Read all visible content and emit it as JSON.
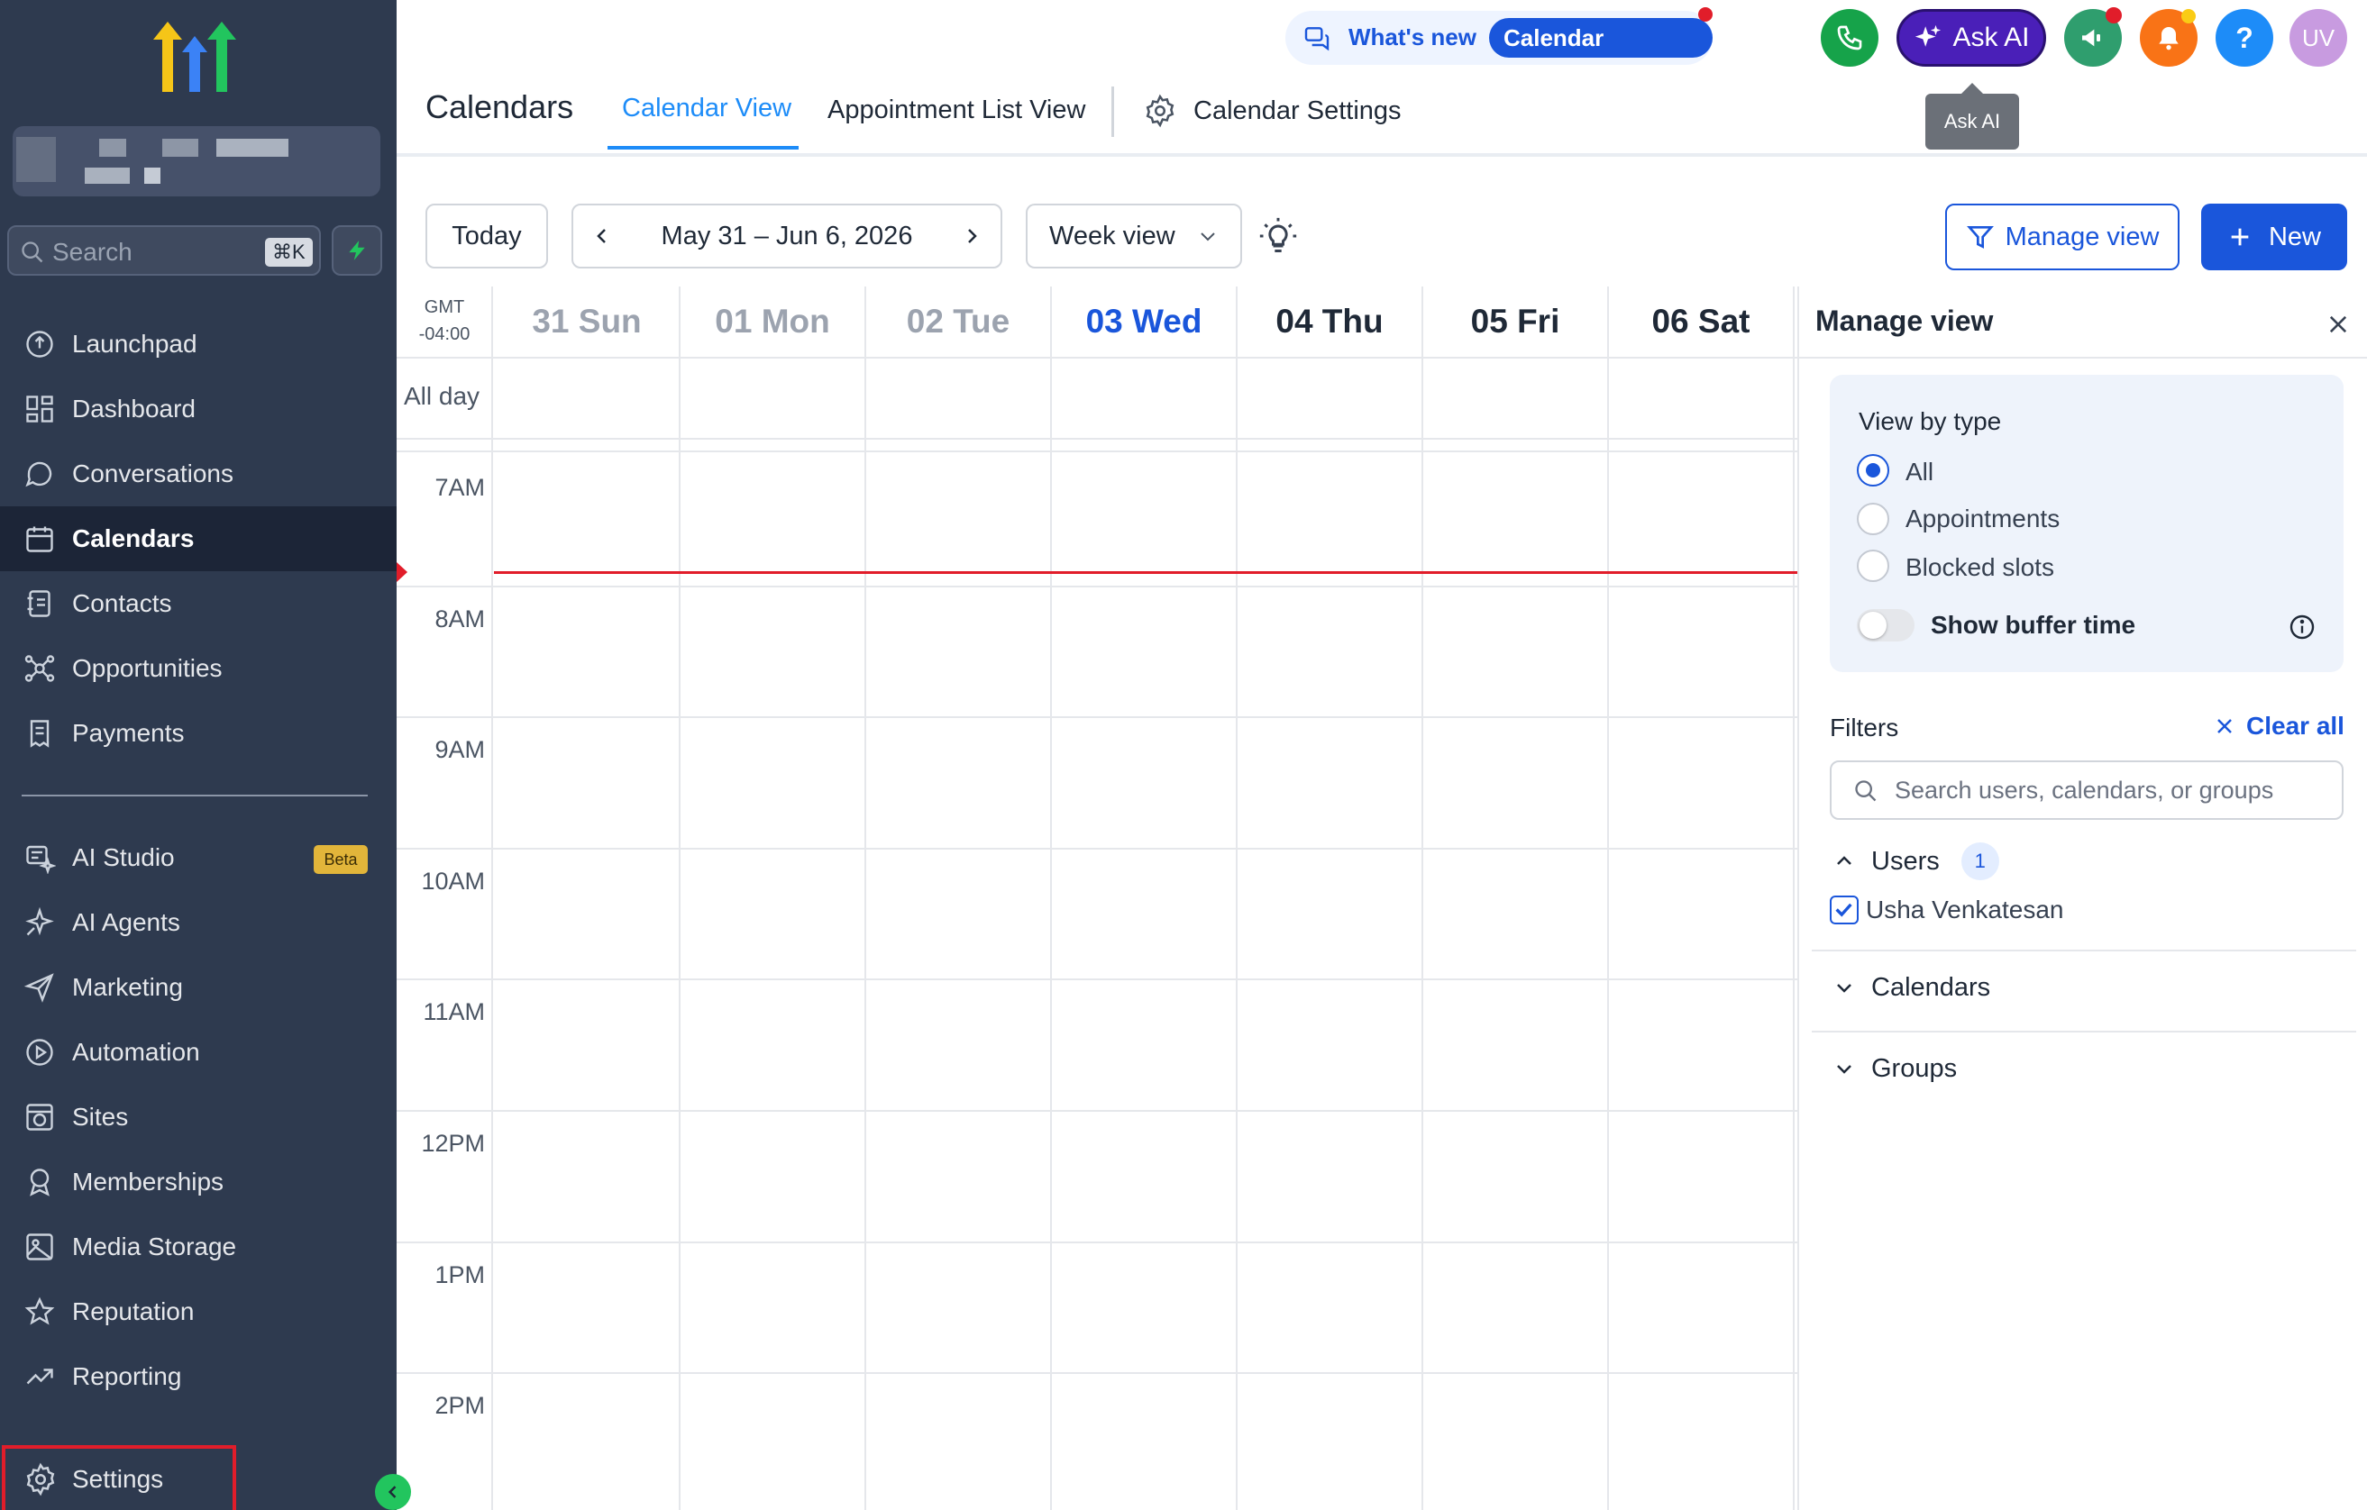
{
  "sidebar": {
    "search_placeholder": "Search",
    "search_shortcut": "⌘K",
    "items_top": [
      {
        "label": "Launchpad",
        "icon": "launchpad-icon"
      },
      {
        "label": "Dashboard",
        "icon": "dashboard-icon"
      },
      {
        "label": "Conversations",
        "icon": "chat-bubble-icon"
      },
      {
        "label": "Calendars",
        "icon": "calendar-icon",
        "active": true
      },
      {
        "label": "Contacts",
        "icon": "contacts-book-icon"
      },
      {
        "label": "Opportunities",
        "icon": "opportunities-icon"
      },
      {
        "label": "Payments",
        "icon": "invoice-icon"
      }
    ],
    "items_bottom": [
      {
        "label": "AI Studio",
        "icon": "ai-studio-icon",
        "badge": "Beta"
      },
      {
        "label": "AI Agents",
        "icon": "sparkle-icon"
      },
      {
        "label": "Marketing",
        "icon": "paper-plane-icon"
      },
      {
        "label": "Automation",
        "icon": "automation-icon"
      },
      {
        "label": "Sites",
        "icon": "globe-window-icon"
      },
      {
        "label": "Memberships",
        "icon": "award-icon"
      },
      {
        "label": "Media Storage",
        "icon": "image-icon"
      },
      {
        "label": "Reputation",
        "icon": "star-icon"
      },
      {
        "label": "Reporting",
        "icon": "trend-line-icon"
      }
    ],
    "settings_label": "Settings"
  },
  "topbar": {
    "whats_new": "What's new",
    "calendar_updates": "Calendar Updates",
    "ask_ai": "Ask AI",
    "ask_ai_tooltip": "Ask AI",
    "help_label": "?",
    "avatar_initials": "UV"
  },
  "header": {
    "title": "Calendars",
    "tabs": [
      "Calendar View",
      "Appointment List View"
    ],
    "settings_tab": "Calendar Settings"
  },
  "toolbar": {
    "today": "Today",
    "date_range": "May 31 – Jun 6, 2026",
    "view_select": "Week view",
    "manage_view": "Manage view",
    "new": "New"
  },
  "calendar": {
    "timezone": [
      "GMT",
      "-04:00"
    ],
    "all_day": "All day",
    "days": [
      {
        "label": "31 Sun",
        "state": "past"
      },
      {
        "label": "01 Mon",
        "state": "past"
      },
      {
        "label": "02 Tue",
        "state": "past"
      },
      {
        "label": "03 Wed",
        "state": "today"
      },
      {
        "label": "04 Thu",
        "state": "future"
      },
      {
        "label": "05 Fri",
        "state": "future"
      },
      {
        "label": "06 Sat",
        "state": "future"
      }
    ],
    "hours": [
      "7AM",
      "8AM",
      "9AM",
      "10AM",
      "11AM",
      "12PM",
      "1PM",
      "2PM"
    ]
  },
  "panel": {
    "title": "Manage view",
    "view_by_type": "View by type",
    "options": [
      "All",
      "Appointments",
      "Blocked slots"
    ],
    "selected": "All",
    "show_buffer_time": "Show buffer time",
    "filters": "Filters",
    "clear_all": "Clear all",
    "search_placeholder": "Search users, calendars, or groups",
    "users_label": "Users",
    "users_count": "1",
    "user_name": "Usha Venkatesan",
    "calendars_label": "Calendars",
    "groups_label": "Groups"
  },
  "colors": {
    "sidebar_bg": "#2e3a4f",
    "primary": "#1a56db",
    "now_line": "#e11d2a",
    "ask_ai": "#4a1fb8",
    "phone": "#16a34a",
    "bell": "#f97316",
    "help": "#1d8cf8",
    "avatar": "#c89be0"
  }
}
